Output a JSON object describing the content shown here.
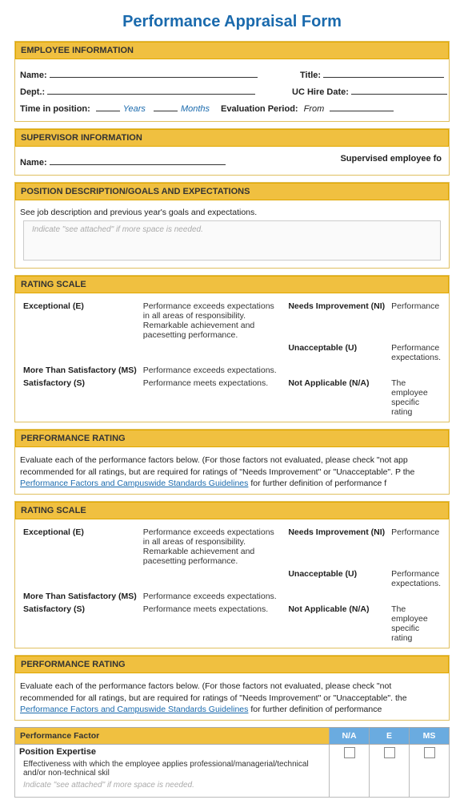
{
  "title": "Performance Appraisal Form",
  "employee_info": {
    "header": "EMPLOYEE INFORMATION",
    "name_label": "Name:",
    "title_label": "Title:",
    "dept_label": "Dept.:",
    "uc_hire_label": "UC Hire Date:",
    "time_label": "Time in position:",
    "years_label": "Years",
    "months_label": "Months",
    "eval_label": "Evaluation Period:",
    "from_label": "From"
  },
  "supervisor_info": {
    "header": "SUPERVISOR INFORMATION",
    "name_label": "Name:",
    "supervised_label": "Supervised employee fo"
  },
  "position_desc": {
    "header": "POSITION DESCRIPTION/GOALS AND EXPECTATIONS",
    "desc_text": "See job description and previous year's goals and expectations.",
    "placeholder": "Indicate \"see attached\" if more space is needed."
  },
  "rating_scale_1": {
    "header": "RATING SCALE",
    "items_left": [
      {
        "term": "Exceptional (E)",
        "desc": "Performance exceeds expectations in all areas of responsibility. Remarkable achievement and pacesetting performance."
      },
      {
        "term": "More Than Satisfactory (MS)",
        "desc": "Performance exceeds expectations."
      },
      {
        "term": "Satisfactory (S)",
        "desc": "Performance meets expectations."
      }
    ],
    "items_right": [
      {
        "term": "Needs Improvement (NI)",
        "desc": "Performance"
      },
      {
        "term": "Unacceptable (U)",
        "desc": "Performance expectations."
      },
      {
        "term": "Not Applicable (N/A)",
        "desc": "The employee specific rating"
      }
    ]
  },
  "performance_rating_1": {
    "header": "PERFORMANCE RATING",
    "text": "Evaluate each of the performance factors below. (For those factors not evaluated, please check \"not app recommended for all ratings, but are required for ratings of \"Needs Improvement\" or \"Unacceptable\". P the ",
    "link_text": "Performance Factors and Campuswide Standards Guidelines",
    "text2": " for further definition of performance f"
  },
  "rating_scale_2": {
    "header": "RATING SCALE",
    "items_left": [
      {
        "term": "Exceptional (E)",
        "desc": "Performance exceeds expectations in all areas of responsibility. Remarkable achievement and pacesetting performance."
      },
      {
        "term": "More Than Satisfactory (MS)",
        "desc": "Performance exceeds expectations."
      },
      {
        "term": "Satisfactory (S)",
        "desc": "Performance meets expectations."
      }
    ],
    "items_right": [
      {
        "term": "Needs Improvement (NI)",
        "desc": "Performance"
      },
      {
        "term": "Unacceptable (U)",
        "desc": "Performance expectations."
      },
      {
        "term": "Not Applicable (N/A)",
        "desc": "The employee specific rating"
      }
    ]
  },
  "performance_rating_2": {
    "header": "PERFORMANCE RATING",
    "text": "Evaluate each of the performance factors below. (For those factors not evaluated, please check \"not recommended for all ratings, but are required for ratings of \"Needs Improvement\" or \"Unacceptable\". the ",
    "link_text": "Performance Factors and Campuswide Standards Guidelines",
    "text2": " for further definition of performance"
  },
  "factor_table": {
    "col_factor": "Performance Factor",
    "col_na": "N/A",
    "col_e": "E",
    "col_ms": "MS",
    "rows": [
      {
        "name": "Position Expertise",
        "desc": "Effectiveness with which the employee applies professional/managerial/technical and/or non-technical skil",
        "placeholder": "Indicate \"see attached\" if more space is needed."
      }
    ]
  }
}
